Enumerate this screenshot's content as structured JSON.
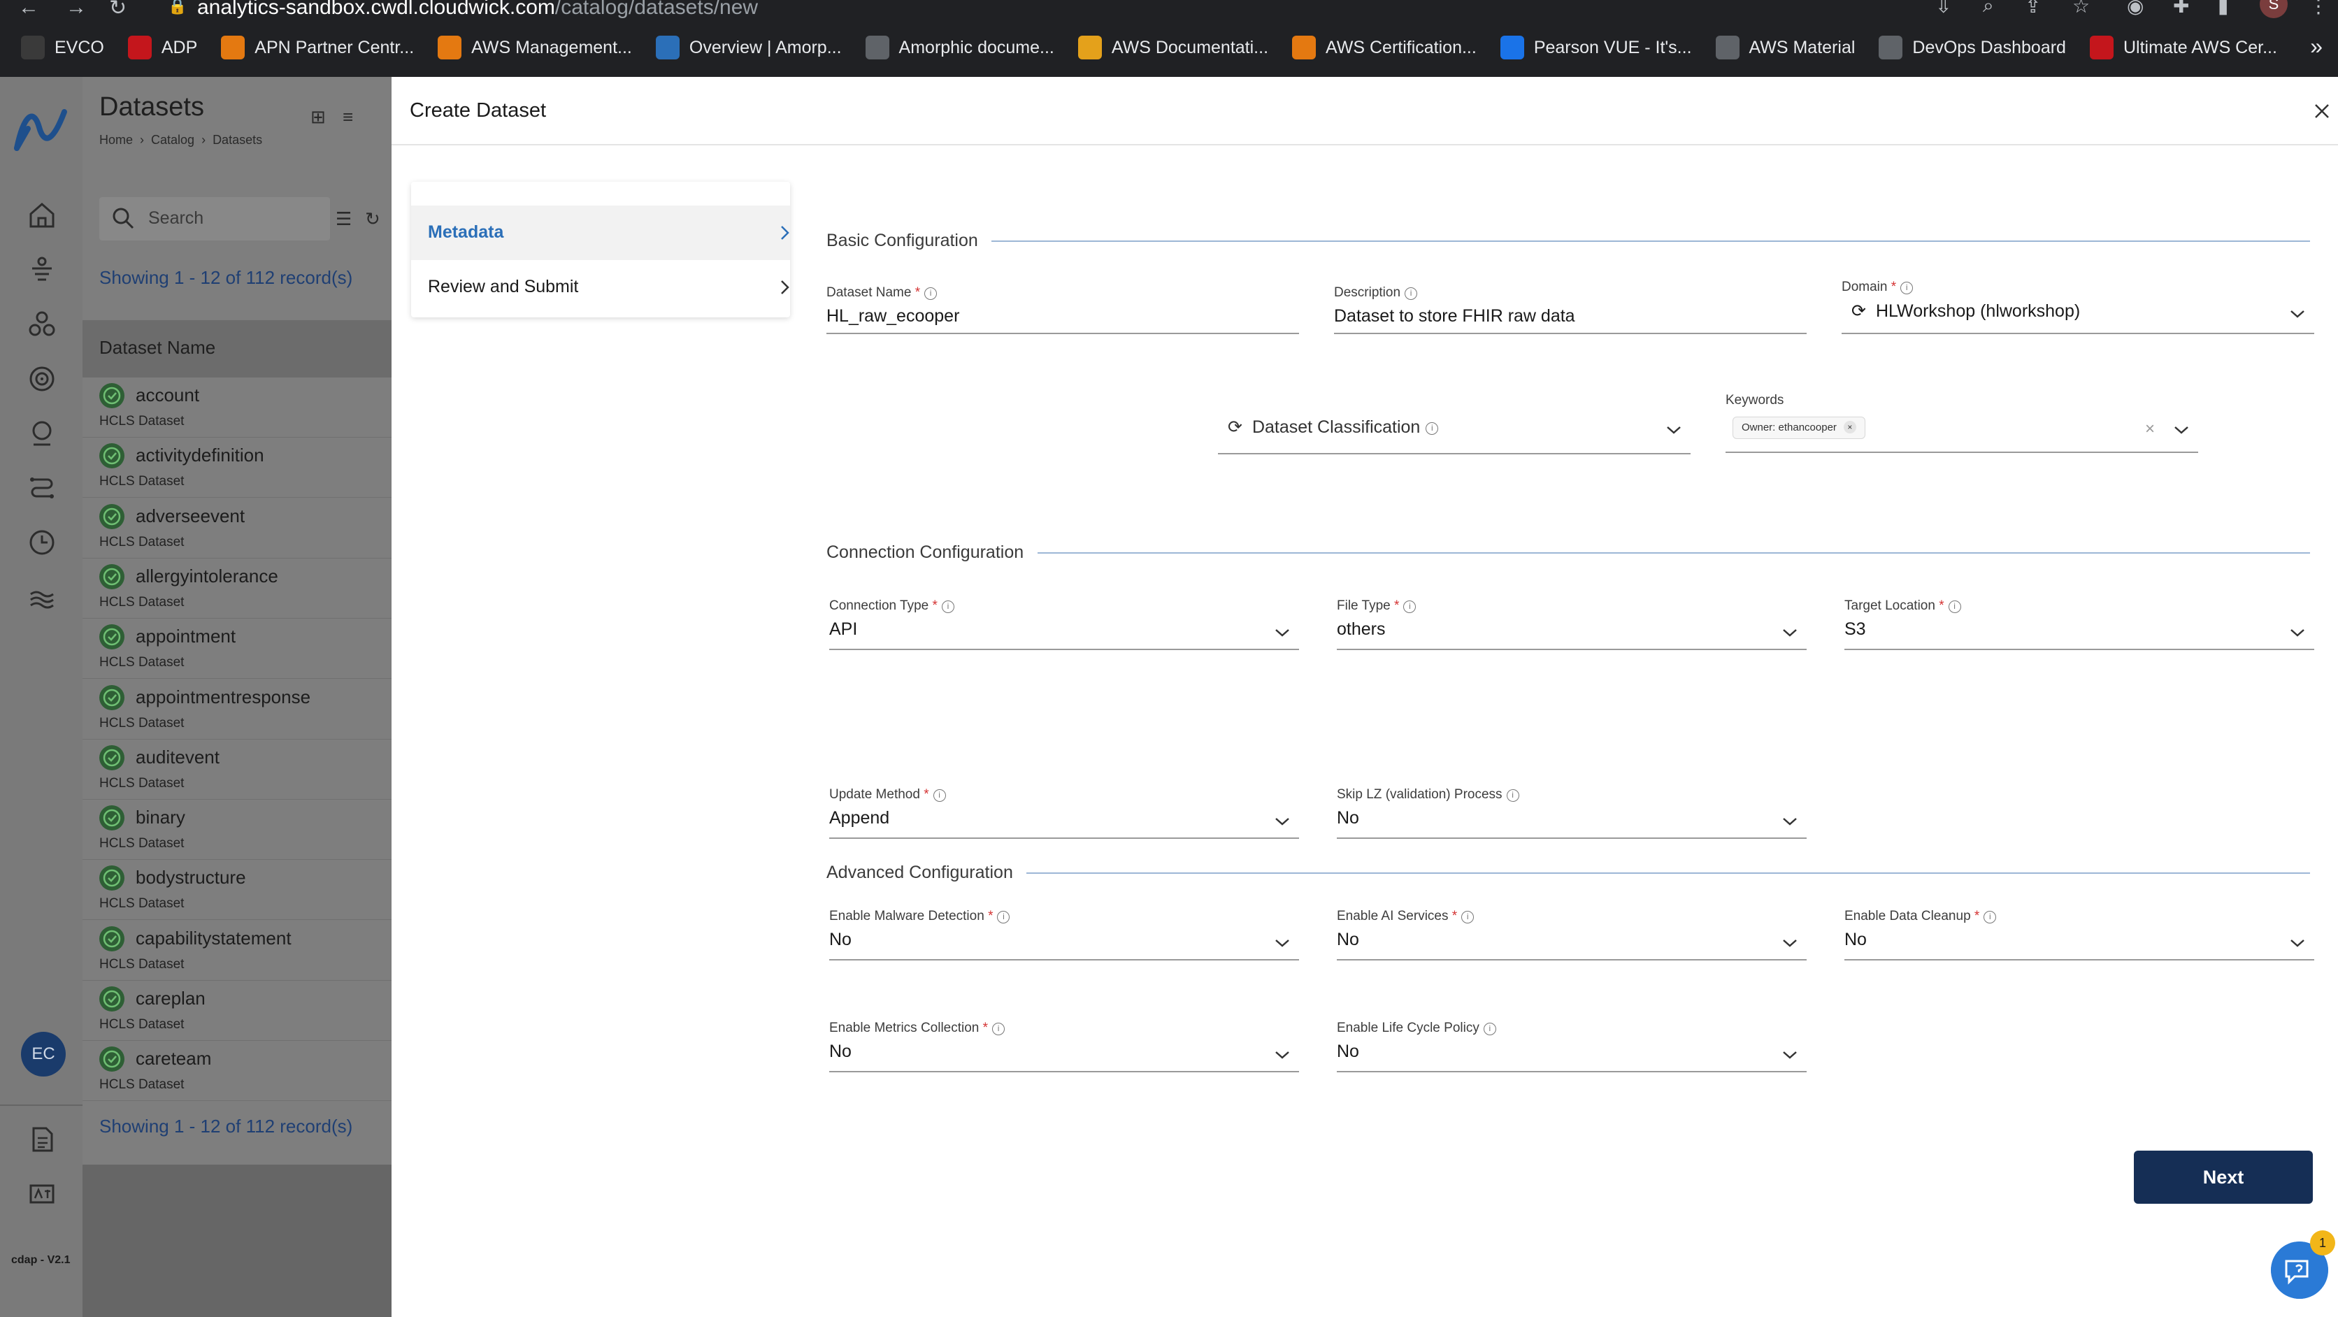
{
  "browser": {
    "url_host": "analytics-sandbox.cwdl.cloudwick.com",
    "url_path": "/catalog/datasets/new",
    "profile_initial": "S",
    "bookmarks": [
      {
        "label": "EVCO",
        "color": "#3a3a3a"
      },
      {
        "label": "ADP",
        "color": "#c4161c"
      },
      {
        "label": "APN Partner Centr...",
        "color": "#e47911"
      },
      {
        "label": "AWS Management...",
        "color": "#e47911"
      },
      {
        "label": "Overview | Amorp...",
        "color": "#2b6fb8"
      },
      {
        "label": "Amorphic docume...",
        "color": "#5f6368"
      },
      {
        "label": "AWS Documentati...",
        "color": "#e4a11b"
      },
      {
        "label": "AWS Certification...",
        "color": "#e47911"
      },
      {
        "label": "Pearson VUE - It's...",
        "color": "#1a73e8"
      },
      {
        "label": "AWS Material",
        "color": "#5f6368"
      },
      {
        "label": "DevOps Dashboard",
        "color": "#5f6368"
      },
      {
        "label": "Ultimate AWS Cer...",
        "color": "#c4161c"
      }
    ],
    "more": "»"
  },
  "rail": {
    "avatar": "EC",
    "version": "cdap - V2.1"
  },
  "list": {
    "title": "Datasets",
    "breadcrumb": [
      "Home",
      "Catalog",
      "Datasets"
    ],
    "search_placeholder": "Search",
    "count_text": "Showing 1 - 12 of 112 record(s)",
    "column_header": "Dataset Name",
    "rows": [
      {
        "name": "account",
        "type": "HCLS Dataset"
      },
      {
        "name": "activitydefinition",
        "type": "HCLS Dataset"
      },
      {
        "name": "adverseevent",
        "type": "HCLS Dataset"
      },
      {
        "name": "allergyintolerance",
        "type": "HCLS Dataset"
      },
      {
        "name": "appointment",
        "type": "HCLS Dataset"
      },
      {
        "name": "appointmentresponse",
        "type": "HCLS Dataset"
      },
      {
        "name": "auditevent",
        "type": "HCLS Dataset"
      },
      {
        "name": "binary",
        "type": "HCLS Dataset"
      },
      {
        "name": "bodystructure",
        "type": "HCLS Dataset"
      },
      {
        "name": "capabilitystatement",
        "type": "HCLS Dataset"
      },
      {
        "name": "careplan",
        "type": "HCLS Dataset"
      },
      {
        "name": "careteam",
        "type": "HCLS Dataset"
      }
    ]
  },
  "drawer": {
    "title": "Create Dataset",
    "steps": [
      {
        "label": "Metadata",
        "active": true
      },
      {
        "label": "Review and Submit",
        "active": false
      }
    ],
    "sections": {
      "basic": "Basic Configuration",
      "connection": "Connection Configuration",
      "advanced": "Advanced Configuration"
    },
    "fields": {
      "dataset_name": {
        "label": "Dataset Name",
        "value": "HL_raw_ecooper",
        "required": true
      },
      "description": {
        "label": "Description",
        "value": "Dataset to store FHIR raw data"
      },
      "domain": {
        "label": "Domain",
        "value": "HLWorkshop (hlworkshop)",
        "required": true
      },
      "classification": {
        "placeholder": "Dataset Classification"
      },
      "keywords": {
        "label": "Keywords",
        "chip": "Owner: ethancooper"
      },
      "connection_type": {
        "label": "Connection Type",
        "value": "API",
        "required": true
      },
      "file_type": {
        "label": "File Type",
        "value": "others",
        "required": true
      },
      "target_location": {
        "label": "Target Location",
        "value": "S3",
        "required": true
      },
      "update_method": {
        "label": "Update Method",
        "value": "Append",
        "required": true
      },
      "skip_lz": {
        "label": "Skip LZ (validation) Process",
        "value": "No"
      },
      "malware": {
        "label": "Enable Malware Detection",
        "value": "No",
        "required": true
      },
      "ai_services": {
        "label": "Enable AI Services",
        "value": "No",
        "required": true
      },
      "data_cleanup": {
        "label": "Enable Data Cleanup",
        "value": "No",
        "required": true
      },
      "metrics": {
        "label": "Enable Metrics Collection",
        "value": "No",
        "required": true
      },
      "lifecycle": {
        "label": "Enable Life Cycle Policy",
        "value": "No"
      }
    },
    "next_label": "Next",
    "help_badge": "1"
  }
}
